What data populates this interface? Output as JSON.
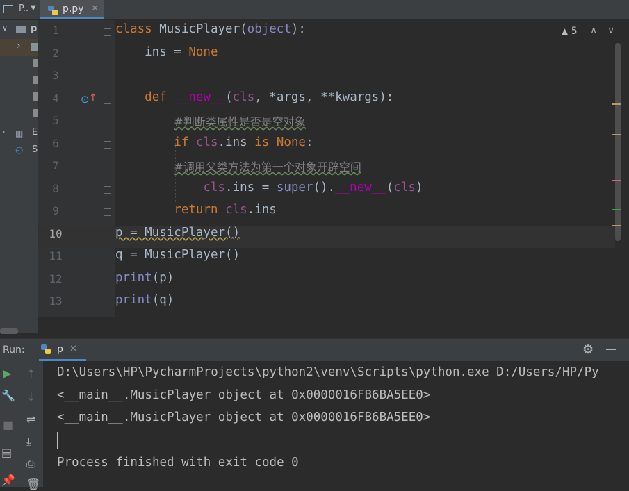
{
  "tabs": {
    "project_label": "P..",
    "file_label": "p.py"
  },
  "tree": {
    "root_label": "p",
    "external_label": "E",
    "scratches_label": "S"
  },
  "editor": {
    "line_numbers": [
      "1",
      "2",
      "3",
      "4",
      "5",
      "6",
      "7",
      "8",
      "9",
      "10",
      "11",
      "12",
      "13"
    ],
    "current_line": 10,
    "lines": [
      [
        {
          "t": "class ",
          "c": "kw"
        },
        {
          "t": "MusicPlayer(",
          "c": ""
        },
        {
          "t": "object",
          "c": "bi"
        },
        {
          "t": "):",
          "c": ""
        }
      ],
      [
        {
          "t": "    ins = ",
          "c": ""
        },
        {
          "t": "None",
          "c": "kw"
        }
      ],
      [],
      [
        {
          "t": "    ",
          "c": ""
        },
        {
          "t": "def ",
          "c": "kw"
        },
        {
          "t": "__new__",
          "c": "mg"
        },
        {
          "t": "(",
          "c": ""
        },
        {
          "t": "cls",
          "c": "sl"
        },
        {
          "t": ", *args, **kwargs):",
          "c": ""
        }
      ],
      [
        {
          "t": "        ",
          "c": ""
        },
        {
          "t": "#判断类属性是否是空对象",
          "c": "cm"
        }
      ],
      [
        {
          "t": "        ",
          "c": ""
        },
        {
          "t": "if ",
          "c": "kw"
        },
        {
          "t": "cls",
          "c": "sl"
        },
        {
          "t": ".ins ",
          "c": ""
        },
        {
          "t": "is ",
          "c": "kw"
        },
        {
          "t": "None",
          "c": "kw"
        },
        {
          "t": ":",
          "c": ""
        }
      ],
      [
        {
          "t": "        ",
          "c": ""
        },
        {
          "t": "#调用父类方法为第一个对象开辟空间",
          "c": "cm"
        }
      ],
      [
        {
          "t": "            ",
          "c": ""
        },
        {
          "t": "cls",
          "c": "sl"
        },
        {
          "t": ".ins = ",
          "c": ""
        },
        {
          "t": "super",
          "c": "bi"
        },
        {
          "t": "().",
          "c": ""
        },
        {
          "t": "__new__",
          "c": "mg"
        },
        {
          "t": "(",
          "c": ""
        },
        {
          "t": "cls",
          "c": "sl"
        },
        {
          "t": ")",
          "c": ""
        }
      ],
      [
        {
          "t": "        ",
          "c": ""
        },
        {
          "t": "return ",
          "c": "kw"
        },
        {
          "t": "cls",
          "c": "sl"
        },
        {
          "t": ".ins",
          "c": ""
        }
      ],
      [
        {
          "t": "p = MusicPlayer()",
          "c": "wv"
        }
      ],
      [
        {
          "t": "q = MusicPlayer()",
          "c": ""
        }
      ],
      [
        {
          "t": "print",
          "c": "bi"
        },
        {
          "t": "(p)",
          "c": ""
        }
      ],
      [
        {
          "t": "print",
          "c": "bi"
        },
        {
          "t": "(q)",
          "c": ""
        }
      ]
    ],
    "warnings_count": "5"
  },
  "run": {
    "label": "Run:",
    "tab_label": "p",
    "output": [
      "D:\\Users\\HP\\PycharmProjects\\python2\\venv\\Scripts\\python.exe D:/Users/HP/Py",
      "<__main__.MusicPlayer object at 0x0000016FB6BA5EE0>",
      "<__main__.MusicPlayer object at 0x0000016FB6BA5EE0>",
      "",
      "Process finished with exit code 0"
    ]
  },
  "icons": {
    "run": "play-icon",
    "settings": "gear-icon",
    "python": "python-icon",
    "warning": "warning-icon"
  }
}
